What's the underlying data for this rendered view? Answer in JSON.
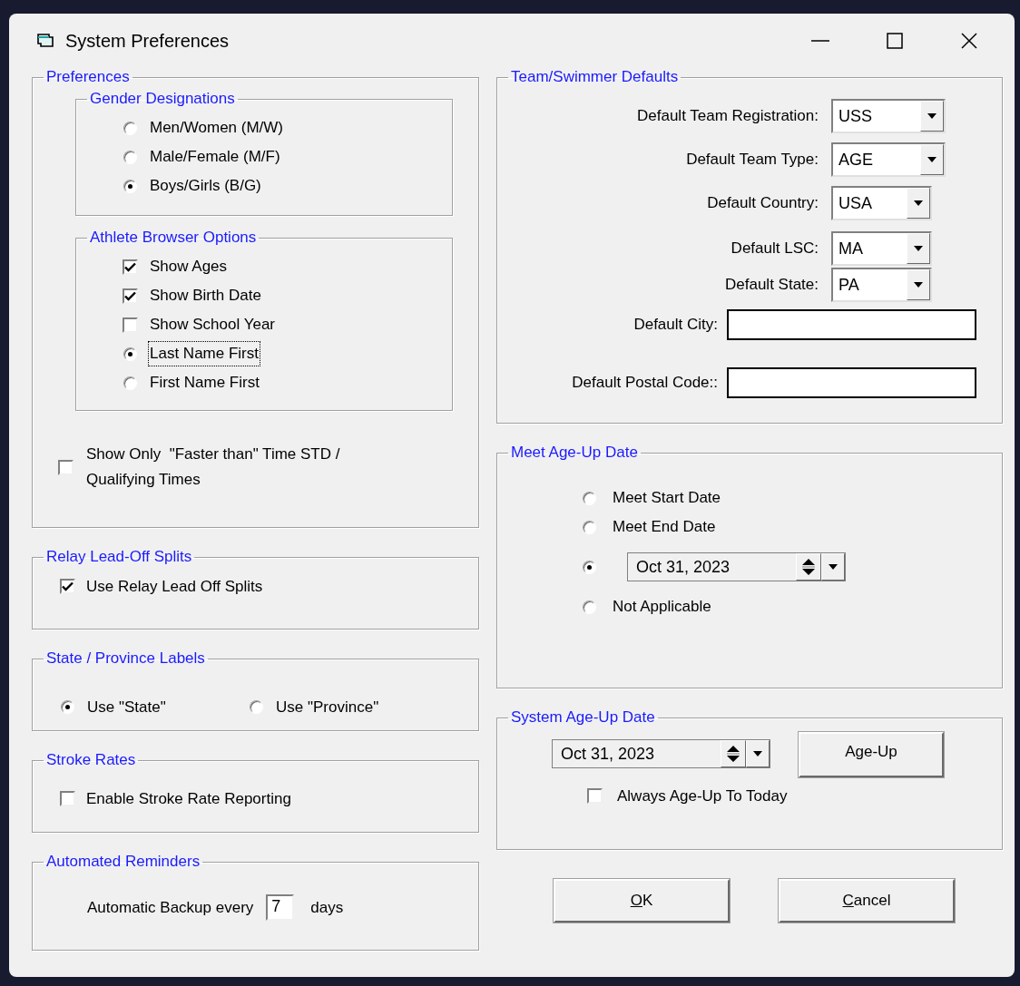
{
  "window": {
    "title": "System Preferences"
  },
  "preferences": {
    "title": "Preferences",
    "gender": {
      "title": "Gender Designations",
      "options": [
        {
          "label": "Men/Women (M/W)",
          "selected": false
        },
        {
          "label": "Male/Female (M/F)",
          "selected": false
        },
        {
          "label": "Boys/Girls (B/G)",
          "selected": true
        }
      ]
    },
    "athlete_browser": {
      "title": "Athlete Browser Options",
      "items": [
        {
          "kind": "checkbox",
          "label": "Show Ages",
          "checked": true
        },
        {
          "kind": "checkbox",
          "label": "Show Birth Date",
          "checked": true
        },
        {
          "kind": "checkbox",
          "label": "Show School Year",
          "checked": false
        },
        {
          "kind": "radio",
          "label": "Last Name First",
          "selected": true,
          "focused": true
        },
        {
          "kind": "radio",
          "label": "First Name First",
          "selected": false,
          "focused": false
        }
      ]
    },
    "faster_than": {
      "label": "Show Only  \"Faster than\" Time STD / Qualifying Times",
      "checked": false
    }
  },
  "relay": {
    "title": "Relay Lead-Off Splits",
    "checkbox": {
      "label": "Use Relay Lead Off Splits",
      "checked": true
    }
  },
  "state_labels": {
    "title": "State / Province Labels",
    "options": [
      {
        "label": "Use \"State\"",
        "selected": true
      },
      {
        "label": "Use \"Province\"",
        "selected": false
      }
    ]
  },
  "stroke_rates": {
    "title": "Stroke Rates",
    "checkbox": {
      "label": "Enable Stroke Rate Reporting",
      "checked": false
    }
  },
  "reminders": {
    "title": "Automated Reminders",
    "label_before": "Automatic Backup every",
    "value": "7",
    "label_after": "days"
  },
  "team_defaults": {
    "title": "Team/Swimmer Defaults",
    "dropdowns": [
      {
        "label": "Default Team Registration:",
        "value": "USS"
      },
      {
        "label": "Default Team Type:",
        "value": "AGE"
      },
      {
        "label": "Default Country:",
        "value": "USA"
      },
      {
        "label": "Default LSC:",
        "value": "MA"
      },
      {
        "label": "Default State:",
        "value": "PA"
      }
    ],
    "fields": [
      {
        "label": "Default City:"
      },
      {
        "label": "Default Postal Code::"
      }
    ]
  },
  "meet_age_up": {
    "title": "Meet Age-Up Date",
    "options": [
      {
        "kind": "radio",
        "label": "Meet Start Date",
        "selected": false
      },
      {
        "kind": "radio",
        "label": "Meet End Date",
        "selected": false
      },
      {
        "kind": "date",
        "date": "Oct 31, 2023",
        "selected": true
      },
      {
        "kind": "radio",
        "label": "Not Applicable",
        "selected": false
      }
    ]
  },
  "system_age_up": {
    "title": "System Age-Up Date",
    "date": "Oct 31, 2023",
    "button": "Age-Up",
    "checkbox": {
      "label": "Always Age-Up To Today",
      "checked": false
    }
  },
  "buttons": [
    {
      "label": "OK"
    },
    {
      "label": "Cancel"
    }
  ]
}
